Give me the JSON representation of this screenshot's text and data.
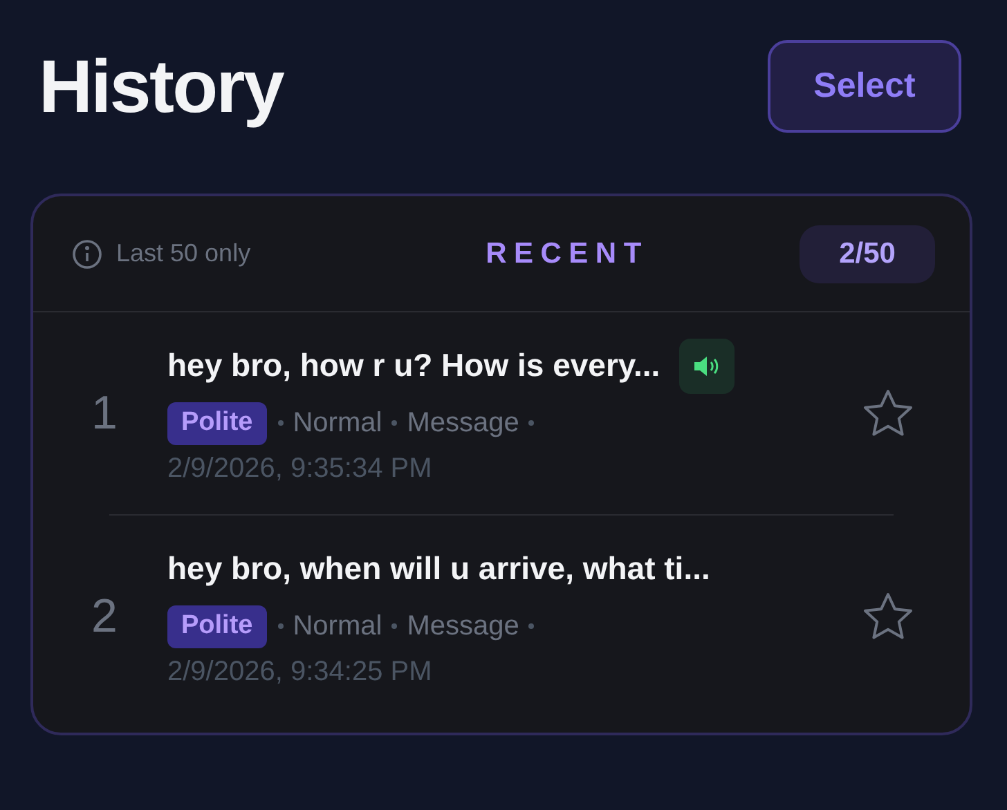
{
  "title": "History",
  "select_button": "Select",
  "card": {
    "note": "Last 50 only",
    "heading": "RECENT",
    "count": "2/50",
    "items": [
      {
        "number": "1",
        "text": "hey bro, how r u? How is every...",
        "audio": true,
        "tag": "Polite",
        "meta": [
          "Normal",
          "Message"
        ],
        "time": "2/9/2026, 9:35:34 PM",
        "starred": false
      },
      {
        "number": "2",
        "text": "hey bro, when will u arrive, what ti...",
        "audio": false,
        "tag": "Polite",
        "meta": [
          "Normal",
          "Message"
        ],
        "time": "2/9/2026, 9:34:25 PM",
        "starred": false
      }
    ]
  }
}
